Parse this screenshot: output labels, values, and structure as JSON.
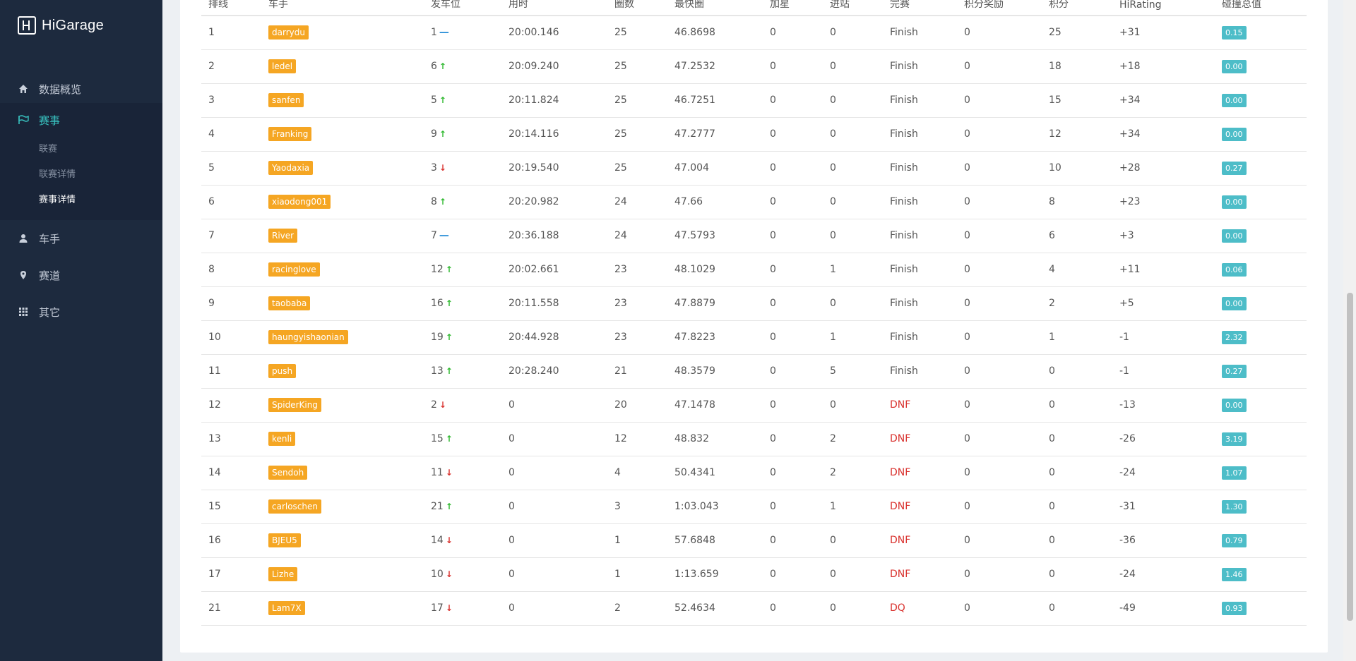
{
  "app": {
    "name": "HiGarage"
  },
  "sidebar": {
    "items": [
      {
        "label": "数据概览",
        "icon": "home-icon"
      },
      {
        "label": "赛事",
        "icon": "flag-icon",
        "active": true
      },
      {
        "label": "车手",
        "icon": "user-icon"
      },
      {
        "label": "赛道",
        "icon": "map-marker-icon"
      },
      {
        "label": "其它",
        "icon": "grid-icon"
      }
    ],
    "sub": [
      {
        "label": "联赛"
      },
      {
        "label": "联赛详情"
      },
      {
        "label": "赛事详情",
        "current": true
      }
    ]
  },
  "table": {
    "headers": [
      "排线",
      "车手",
      "发车位",
      "用时",
      "圈数",
      "最快圈",
      "加星",
      "进站",
      "完赛",
      "积分奖励",
      "积分",
      "HiRating",
      "碰撞总值"
    ],
    "rows": [
      {
        "pos": "1",
        "driver": "darrydu",
        "grid": "1",
        "dir": "flat",
        "time": "20:00.146",
        "laps": "25",
        "fastest": "46.8698",
        "bonus": "0",
        "pit": "0",
        "status": "Finish",
        "award": "0",
        "points": "25",
        "rating": "+31",
        "collision": "0.15"
      },
      {
        "pos": "2",
        "driver": "ledel",
        "grid": "6",
        "dir": "up",
        "time": "20:09.240",
        "laps": "25",
        "fastest": "47.2532",
        "bonus": "0",
        "pit": "0",
        "status": "Finish",
        "award": "0",
        "points": "18",
        "rating": "+18",
        "collision": "0.00"
      },
      {
        "pos": "3",
        "driver": "sanfen",
        "grid": "5",
        "dir": "up",
        "time": "20:11.824",
        "laps": "25",
        "fastest": "46.7251",
        "bonus": "0",
        "pit": "0",
        "status": "Finish",
        "award": "0",
        "points": "15",
        "rating": "+34",
        "collision": "0.00"
      },
      {
        "pos": "4",
        "driver": "Franking",
        "grid": "9",
        "dir": "up",
        "time": "20:14.116",
        "laps": "25",
        "fastest": "47.2777",
        "bonus": "0",
        "pit": "0",
        "status": "Finish",
        "award": "0",
        "points": "12",
        "rating": "+34",
        "collision": "0.00"
      },
      {
        "pos": "5",
        "driver": "Yaodaxia",
        "grid": "3",
        "dir": "down",
        "time": "20:19.540",
        "laps": "25",
        "fastest": "47.004",
        "bonus": "0",
        "pit": "0",
        "status": "Finish",
        "award": "0",
        "points": "10",
        "rating": "+28",
        "collision": "0.27"
      },
      {
        "pos": "6",
        "driver": "xiaodong001",
        "grid": "8",
        "dir": "up",
        "time": "20:20.982",
        "laps": "24",
        "fastest": "47.66",
        "bonus": "0",
        "pit": "0",
        "status": "Finish",
        "award": "0",
        "points": "8",
        "rating": "+23",
        "collision": "0.00"
      },
      {
        "pos": "7",
        "driver": "River",
        "grid": "7",
        "dir": "flat",
        "time": "20:36.188",
        "laps": "24",
        "fastest": "47.5793",
        "bonus": "0",
        "pit": "0",
        "status": "Finish",
        "award": "0",
        "points": "6",
        "rating": "+3",
        "collision": "0.00"
      },
      {
        "pos": "8",
        "driver": "racinglove",
        "grid": "12",
        "dir": "up",
        "time": "20:02.661",
        "laps": "23",
        "fastest": "48.1029",
        "bonus": "0",
        "pit": "1",
        "status": "Finish",
        "award": "0",
        "points": "4",
        "rating": "+11",
        "collision": "0.06"
      },
      {
        "pos": "9",
        "driver": "taobaba",
        "grid": "16",
        "dir": "up",
        "time": "20:11.558",
        "laps": "23",
        "fastest": "47.8879",
        "bonus": "0",
        "pit": "0",
        "status": "Finish",
        "award": "0",
        "points": "2",
        "rating": "+5",
        "collision": "0.00"
      },
      {
        "pos": "10",
        "driver": "haungyishaonian",
        "grid": "19",
        "dir": "up",
        "time": "20:44.928",
        "laps": "23",
        "fastest": "47.8223",
        "bonus": "0",
        "pit": "1",
        "status": "Finish",
        "award": "0",
        "points": "1",
        "rating": "-1",
        "collision": "2.32"
      },
      {
        "pos": "11",
        "driver": "push",
        "grid": "13",
        "dir": "up",
        "time": "20:28.240",
        "laps": "21",
        "fastest": "48.3579",
        "bonus": "0",
        "pit": "5",
        "status": "Finish",
        "award": "0",
        "points": "0",
        "rating": "-1",
        "collision": "0.27"
      },
      {
        "pos": "12",
        "driver": "SpiderKing",
        "grid": "2",
        "dir": "down",
        "time": "0",
        "laps": "20",
        "fastest": "47.1478",
        "bonus": "0",
        "pit": "0",
        "status": "DNF",
        "award": "0",
        "points": "0",
        "rating": "-13",
        "collision": "0.00"
      },
      {
        "pos": "13",
        "driver": "kenli",
        "grid": "15",
        "dir": "up",
        "time": "0",
        "laps": "12",
        "fastest": "48.832",
        "bonus": "0",
        "pit": "2",
        "status": "DNF",
        "award": "0",
        "points": "0",
        "rating": "-26",
        "collision": "3.19"
      },
      {
        "pos": "14",
        "driver": "Sendoh",
        "grid": "11",
        "dir": "down",
        "time": "0",
        "laps": "4",
        "fastest": "50.4341",
        "bonus": "0",
        "pit": "2",
        "status": "DNF",
        "award": "0",
        "points": "0",
        "rating": "-24",
        "collision": "1.07"
      },
      {
        "pos": "15",
        "driver": "carloschen",
        "grid": "21",
        "dir": "up",
        "time": "0",
        "laps": "3",
        "fastest": "1:03.043",
        "bonus": "0",
        "pit": "1",
        "status": "DNF",
        "award": "0",
        "points": "0",
        "rating": "-31",
        "collision": "1.30"
      },
      {
        "pos": "16",
        "driver": "BJEU5",
        "grid": "14",
        "dir": "down",
        "time": "0",
        "laps": "1",
        "fastest": "57.6848",
        "bonus": "0",
        "pit": "0",
        "status": "DNF",
        "award": "0",
        "points": "0",
        "rating": "-36",
        "collision": "0.79"
      },
      {
        "pos": "17",
        "driver": "Lizhe",
        "grid": "10",
        "dir": "down",
        "time": "0",
        "laps": "1",
        "fastest": "1:13.659",
        "bonus": "0",
        "pit": "0",
        "status": "DNF",
        "award": "0",
        "points": "0",
        "rating": "-24",
        "collision": "1.46"
      },
      {
        "pos": "21",
        "driver": "Lam7X",
        "grid": "17",
        "dir": "down",
        "time": "0",
        "laps": "2",
        "fastest": "52.4634",
        "bonus": "0",
        "pit": "0",
        "status": "DQ",
        "award": "0",
        "points": "0",
        "rating": "-49",
        "collision": "0.93"
      }
    ]
  },
  "colors": {
    "sidebar": "#1d2a3e",
    "accent": "#38c1bf",
    "tag": "#f5a623",
    "badge": "#4dbdc8",
    "dnf": "#d9322e",
    "up": "#2eb82e",
    "flat": "#2a8fd8"
  }
}
